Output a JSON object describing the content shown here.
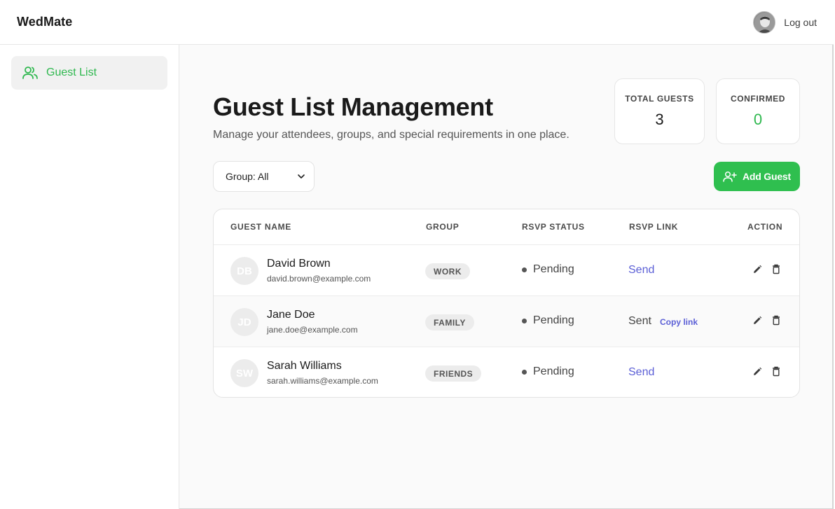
{
  "header": {
    "brand": "WedMate",
    "logout_label": "Log out"
  },
  "sidebar": {
    "items": [
      {
        "label": "Guest List",
        "icon": "users-icon"
      }
    ]
  },
  "main": {
    "title": "Guest List Management",
    "subtitle": "Manage your attendees, groups, and special requirements in one place.",
    "stats": {
      "total_label": "TOTAL GUESTS",
      "total_value": "3",
      "confirmed_label": "CONFIRMED",
      "confirmed_value": "0"
    },
    "filter": {
      "label": "Group: All"
    },
    "add_button_label": "Add Guest",
    "table": {
      "columns": [
        "GUEST NAME",
        "GROUP",
        "RSVP STATUS",
        "RSVP LINK",
        "ACTION"
      ],
      "rows": [
        {
          "initials": "DB",
          "name": "David Brown",
          "email": "david.brown@example.com",
          "group": "WORK",
          "status": "Pending",
          "link": "Send"
        },
        {
          "initials": "JD",
          "name": "Jane Doe",
          "email": "jane.doe@example.com",
          "group": "FAMILY",
          "status": "Pending",
          "link": "Sent",
          "copy_label": "Copy link"
        },
        {
          "initials": "SW",
          "name": "Sarah Williams",
          "email": "sarah.williams@example.com",
          "group": "FRIENDS",
          "status": "Pending",
          "link": "Send"
        }
      ]
    }
  },
  "colors": {
    "accent_green": "#2fbf4f",
    "link_blue": "#5b5fd6"
  }
}
